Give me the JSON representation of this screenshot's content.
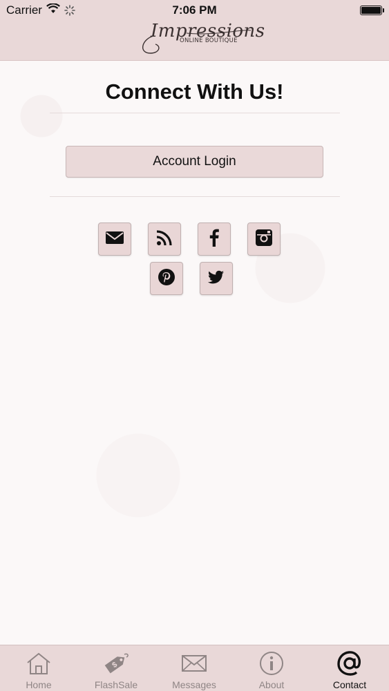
{
  "status_bar": {
    "carrier": "Carrier",
    "time": "7:06 PM"
  },
  "header": {
    "logo_script": "Impressions",
    "logo_sub": "ONLINE BOUTIQUE"
  },
  "main": {
    "title": "Connect With Us!",
    "login_label": "Account Login",
    "social_icons": [
      "email-icon",
      "rss-icon",
      "facebook-icon",
      "instagram-icon",
      "pinterest-icon",
      "twitter-icon"
    ]
  },
  "tabbar": {
    "items": [
      {
        "label": "Home",
        "icon": "home-icon"
      },
      {
        "label": "FlashSale",
        "icon": "price-tag-icon"
      },
      {
        "label": "Messages",
        "icon": "envelope-icon"
      },
      {
        "label": "About",
        "icon": "info-icon"
      },
      {
        "label": "Contact",
        "icon": "at-sign-icon"
      }
    ],
    "active_index": 4
  },
  "colors": {
    "header_bg": "#e9d8d8",
    "button_bg": "#ead9d9",
    "page_bg": "#fbf8f8",
    "tab_inactive": "#8f8585",
    "tab_active": "#111111"
  }
}
